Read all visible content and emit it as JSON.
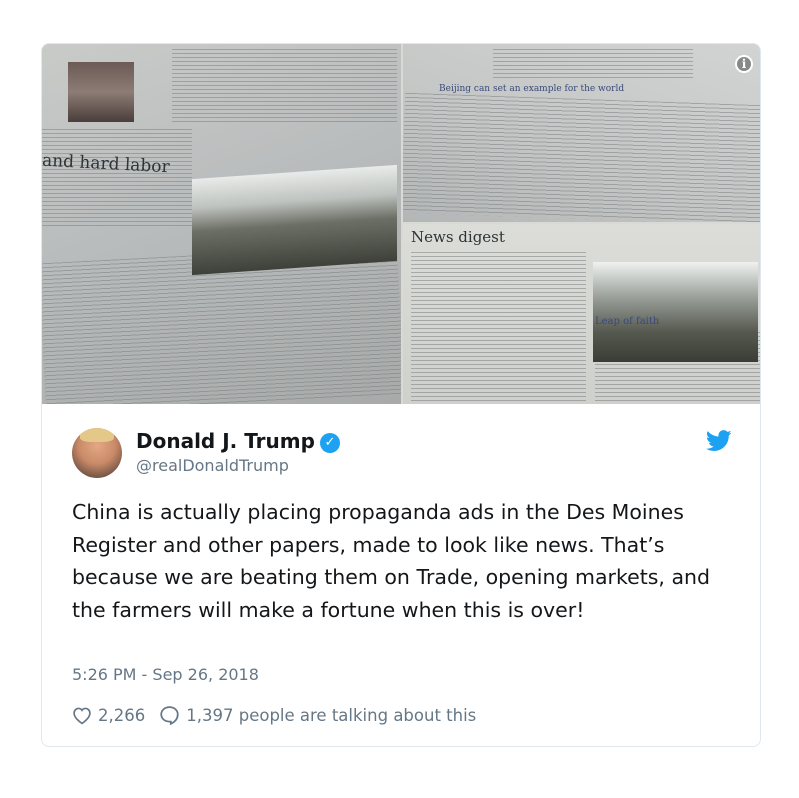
{
  "media": {
    "photo1_headline": "and hard labor",
    "photo2_headline": "Beijing can set an example for the world",
    "photo3_headline": "News digest",
    "photo3_caption": "Leap of faith"
  },
  "tweet": {
    "author_name": "Donald J. Trump",
    "author_handle": "@realDonaldTrump",
    "text": "China is actually placing propaganda ads in the Des Moines Register and other papers, made to look like news. That’s because we are beating them on Trade, opening markets, and the farmers will make a fortune when this is over!",
    "timestamp": "5:26 PM - Sep 26, 2018",
    "likes": "2,266",
    "replies_label": "1,397 people are talking about this"
  },
  "icons": {
    "verified": "verified-badge-icon",
    "twitter": "twitter-bird-icon",
    "info": "info-icon",
    "like": "heart-icon",
    "reply": "speech-bubble-icon"
  },
  "colors": {
    "twitter_blue": "#1da1f2",
    "secondary_text": "#657786",
    "border": "#e1e8ed"
  }
}
